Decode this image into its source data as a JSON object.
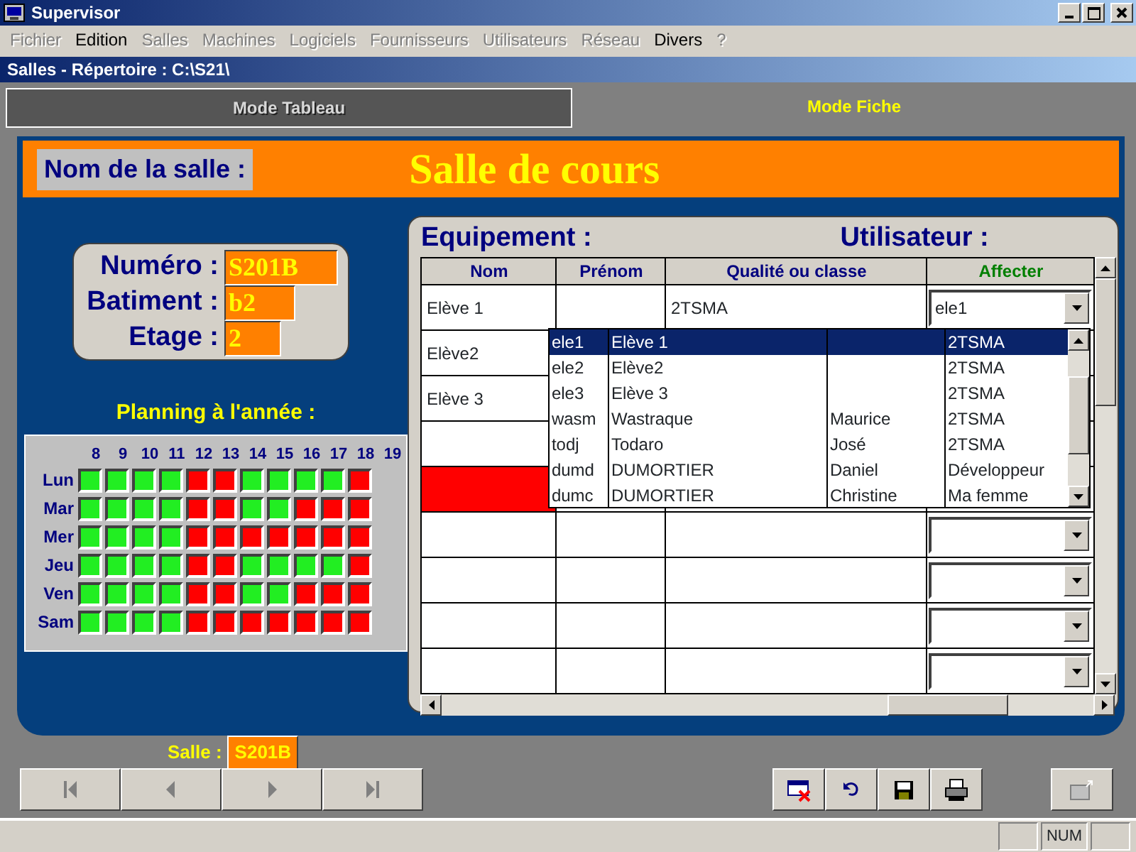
{
  "window": {
    "title": "Supervisor"
  },
  "menu": [
    {
      "label": "Fichier",
      "disabled": true
    },
    {
      "label": "Edition",
      "disabled": false
    },
    {
      "label": "Salles",
      "disabled": true
    },
    {
      "label": "Machines",
      "disabled": true
    },
    {
      "label": "Logiciels",
      "disabled": true
    },
    {
      "label": "Fournisseurs",
      "disabled": true
    },
    {
      "label": "Utilisateurs",
      "disabled": true
    },
    {
      "label": "Réseau",
      "disabled": true
    },
    {
      "label": "Divers",
      "disabled": false
    },
    {
      "label": "?",
      "disabled": true
    }
  ],
  "location_bar": "Salles - Répertoire : C:\\S21\\",
  "tabs": [
    {
      "label": "Mode Tableau",
      "selected": false
    },
    {
      "label": "Mode Fiche",
      "selected": true
    }
  ],
  "header": {
    "label": "Nom de la salle :",
    "value": "Salle de cours"
  },
  "info": [
    {
      "label": "Numéro :",
      "value": "S201B"
    },
    {
      "label": "Batiment :",
      "value": "b2"
    },
    {
      "label": "Etage :",
      "value": "2"
    }
  ],
  "planning": {
    "title": "Planning à l'année :",
    "hours": [
      "8",
      "9",
      "10",
      "11",
      "12",
      "13",
      "14",
      "15",
      "16",
      "17",
      "18",
      "19"
    ],
    "rows": [
      {
        "day": "Lun",
        "busy": [
          false,
          false,
          false,
          false,
          true,
          true,
          false,
          false,
          false,
          false,
          true
        ]
      },
      {
        "day": "Mar",
        "busy": [
          false,
          false,
          false,
          false,
          true,
          true,
          false,
          false,
          true,
          true,
          true
        ]
      },
      {
        "day": "Mer",
        "busy": [
          false,
          false,
          false,
          false,
          true,
          true,
          true,
          true,
          true,
          true,
          true
        ]
      },
      {
        "day": "Jeu",
        "busy": [
          false,
          false,
          false,
          false,
          true,
          true,
          false,
          false,
          false,
          false,
          true
        ]
      },
      {
        "day": "Ven",
        "busy": [
          false,
          false,
          false,
          false,
          true,
          true,
          false,
          false,
          true,
          true,
          true
        ]
      },
      {
        "day": "Sam",
        "busy": [
          false,
          false,
          false,
          false,
          true,
          true,
          true,
          true,
          true,
          true,
          true
        ]
      }
    ]
  },
  "equipement_label": "Equipement :",
  "utilisateur_label": "Utilisateur :",
  "table": {
    "columns": [
      {
        "label": "Nom",
        "color": "#00007f"
      },
      {
        "label": "Prénom",
        "color": "#00007f"
      },
      {
        "label": "Qualité ou classe",
        "color": "#00007f"
      },
      {
        "label": "Affecter",
        "color": "#007f00"
      }
    ],
    "rows": [
      {
        "nom": "Elève 1",
        "classe": "2TSMA",
        "affecter": "ele1",
        "kind": "combo",
        "flagged": false
      },
      {
        "nom": "Elève2",
        "kind": "plain",
        "flagged": false
      },
      {
        "nom": "Elève 3",
        "kind": "plain",
        "flagged": false
      },
      {
        "kind": "plain",
        "flagged": false
      },
      {
        "kind": "plain",
        "flagged": true
      },
      {
        "kind": "combo",
        "flagged": false
      },
      {
        "kind": "combo",
        "flagged": false
      },
      {
        "kind": "combo",
        "flagged": false
      },
      {
        "kind": "combo",
        "flagged": false
      }
    ]
  },
  "dropdown": [
    {
      "login": "ele1",
      "nom": "Elève 1",
      "classe": "2TSMA",
      "selected": true
    },
    {
      "login": "ele2",
      "nom": "Elève2",
      "classe": "2TSMA",
      "selected": false
    },
    {
      "login": "ele3",
      "nom": "Elève 3",
      "classe": "2TSMA",
      "selected": false
    },
    {
      "login": "wasm",
      "nom": "Wastraque",
      "prenom": "Maurice",
      "classe": "2TSMA",
      "selected": false
    },
    {
      "login": "todj",
      "nom": "Todaro",
      "prenom": "José",
      "classe": "2TSMA",
      "selected": false
    },
    {
      "login": "dumd",
      "nom": "DUMORTIER",
      "prenom": "Daniel",
      "classe": "Développeur",
      "selected": false
    },
    {
      "login": "dumc",
      "nom": "DUMORTIER",
      "prenom": "Christine",
      "classe": "Ma femme",
      "selected": false
    }
  ],
  "footer": {
    "label": "Salle :",
    "value": "S201B"
  },
  "status_bar": {
    "num": "NUM"
  }
}
